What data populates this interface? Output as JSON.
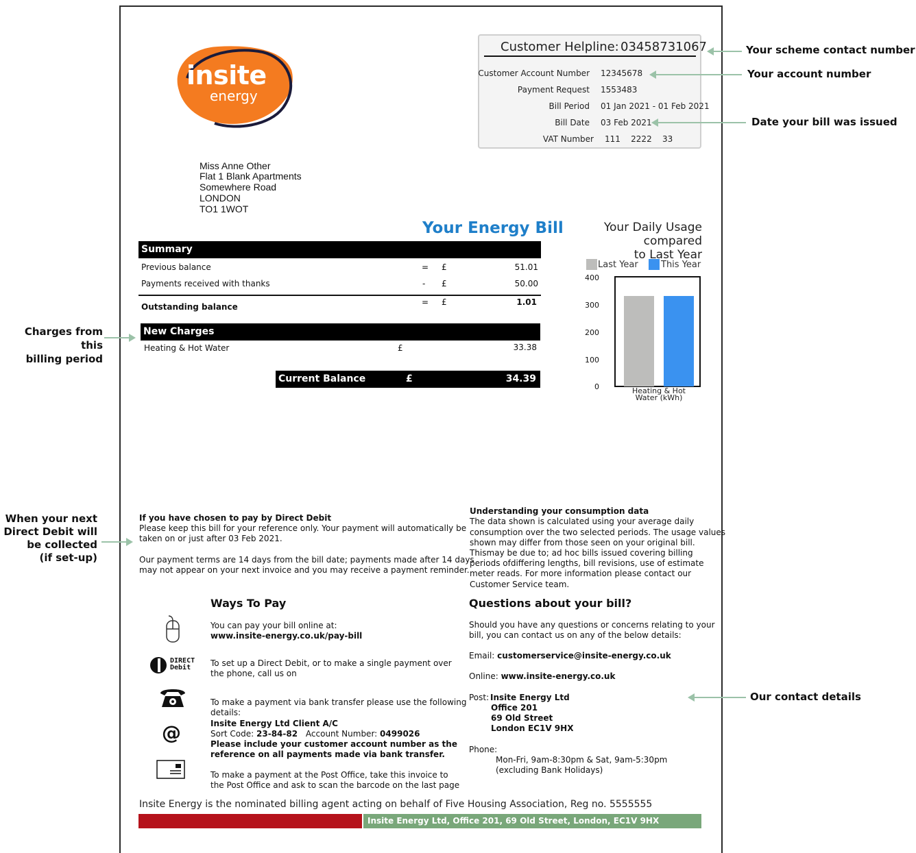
{
  "logo": {
    "word_main": "insite",
    "word_sub": "energy"
  },
  "helpline": {
    "label": "Customer Helpline:",
    "number": "03458731067"
  },
  "account_info": [
    {
      "label": "Customer Account Number",
      "value": "12345678"
    },
    {
      "label": "Payment Request",
      "value": "1553483"
    },
    {
      "label": "Bill Period",
      "value": "01 Jan 2021 - 01 Feb 2021"
    },
    {
      "label": "Bill Date",
      "value": "03 Feb 2021"
    },
    {
      "label": "VAT Number",
      "value": "111    2222    33"
    }
  ],
  "address": [
    "Miss Anne Other",
    "Flat 1 Blank Apartments",
    "Somewhere Road",
    "LONDON",
    "TO1 1WOT"
  ],
  "bill_title": "Your Energy Bill",
  "summary": {
    "header": "Summary",
    "rows": [
      {
        "label": "Previous balance",
        "sign": "=",
        "currency": "£",
        "value": "51.01"
      },
      {
        "label": "Payments received with thanks",
        "sign": "-",
        "currency": "£",
        "value": "50.00"
      }
    ],
    "outstanding": {
      "label": "Outstanding balance",
      "sign": "=",
      "currency": "£",
      "value": "1.01"
    }
  },
  "new_charges": {
    "header": "New Charges",
    "rows": [
      {
        "label": "Heating & Hot Water",
        "currency": "£",
        "value": "33.38"
      }
    ]
  },
  "current_balance": {
    "label": "Current Balance",
    "currency": "£",
    "value": "34.39"
  },
  "chart_data": {
    "type": "bar",
    "title": "Your Daily Usage compared to Last Year",
    "title_line1": "Your Daily Usage compared",
    "title_line2": "to Last Year",
    "categories": [
      "Heating & Hot Water (kWh)"
    ],
    "category_line1": "Heating & Hot",
    "category_line2": "Water (kWh)",
    "series": [
      {
        "name": "Last Year",
        "values": [
          330
        ],
        "color": "#bdbdbb"
      },
      {
        "name": "This Year",
        "values": [
          330
        ],
        "color": "#3a92f0"
      }
    ],
    "ylim": [
      0,
      400
    ],
    "yticks": [
      "400",
      "300",
      "200",
      "100",
      "0"
    ],
    "legend": "top"
  },
  "direct_debit_info": {
    "heading": "If you have chosen to pay by Direct Debit",
    "lines": [
      "Please keep this bill for your reference only. Your payment will automatically be",
      "taken on or just after 03 Feb 2021."
    ],
    "terms_lines": [
      "Our payment terms are 14 days from the bill date; payments made after 14 days",
      "may not appear on your next invoice and you may receive a payment reminder."
    ]
  },
  "consumption": {
    "heading": "Understanding your consumption data",
    "lines": [
      "The data shown is calculated using your average daily",
      "consumption over the two selected periods. The usage values",
      "shown may differ from those seen on your original bill.",
      "Thismay be due to; ad hoc bills issued covering billing",
      "periods ofdiffering lengths, bill revisions, use of estimate",
      "meter reads. For more information please contact our",
      "Customer Service team."
    ]
  },
  "ways_to_pay": {
    "heading": "Ways To Pay",
    "online_lines": [
      "You can pay your bill online at:",
      "www.insite-energy.co.uk/pay-bill"
    ],
    "dd_lines": [
      "To set up a Direct Debit, or to make a single payment over",
      "the phone, call us on"
    ],
    "dd_logo_line1": "DIRECT",
    "dd_logo_line2": "Debit",
    "bank_lines": [
      "To make a payment via bank transfer please use the following",
      "details:"
    ],
    "bank_account": "Insite Energy Ltd Client A/C",
    "sort_code_label": "Sort Code:",
    "sort_code": "23-84-82",
    "account_number_label": "Account Number:",
    "account_number": "0499026",
    "bank_note_lines": [
      "Please include your customer account number as the",
      "reference on all payments made via bank transfer."
    ],
    "post_lines": [
      "To make a payment at the Post Office, take this invoice to",
      "the Post Office and ask to scan the barcode on the last page"
    ],
    "at_symbol": "@"
  },
  "questions": {
    "heading": "Questions about your bill?",
    "intro_lines": [
      "Should you have any questions or concerns relating to your",
      "bill, you can contact us on any of the below details:"
    ],
    "email_label": "Email:",
    "email": "customerservice@insite-energy.co.uk",
    "online_label": "Online:",
    "online": "www.insite-energy.co.uk",
    "post_label": "Post:",
    "post_lines": [
      "Insite Energy Ltd",
      "Office 201",
      "69 Old Street",
      "London EC1V 9HX"
    ],
    "phone_label": "Phone:",
    "phone_lines": [
      "Mon-Fri, 9am-8:30pm & Sat, 9am-5:30pm",
      "(excluding Bank Holidays)"
    ]
  },
  "footer": {
    "agent_text": "Insite Energy is the nominated billing agent acting on behalf of Five Housing Association, Reg no. 5555555",
    "address_bar": "Insite Energy Ltd, Office 201, 69 Old Street, London, EC1V 9HX"
  },
  "annotations": {
    "scheme_contact": "Your scheme contact number",
    "account_number": "Your account number",
    "date_issued": "Date your bill was issued",
    "charges_line1": "Charges from this",
    "charges_line2": "billing period",
    "dd_line1": "When your next",
    "dd_line2": "Direct Debit will",
    "dd_line3": "be collected",
    "dd_line4": "(if set-up)",
    "contact_details": "Our contact details"
  },
  "colors": {
    "brand_orange": "#f47b20",
    "title_blue": "#1f7fc9",
    "annotation_green": "#9bc2a8",
    "footer_red": "#b5121b",
    "footer_green": "#79a77a"
  }
}
